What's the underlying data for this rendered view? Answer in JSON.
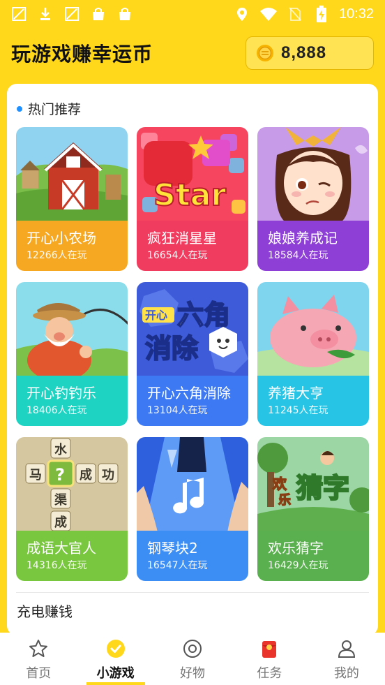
{
  "status_bar": {
    "time": "10:32",
    "left_icons": [
      "no-image-icon",
      "download-icon",
      "no-image-icon",
      "shopping-bag-icon",
      "shopping-bag-icon"
    ],
    "right_icons": [
      "location-icon",
      "wifi-icon",
      "no-sim-icon",
      "battery-charging-icon"
    ]
  },
  "header": {
    "title": "玩游戏赚幸运币",
    "coin_balance": "8,888",
    "coin_icon": "coin-icon"
  },
  "section": {
    "title": "热门推荐",
    "accent": "#1E90FF"
  },
  "games": [
    {
      "name": "开心小农场",
      "players": "12266人在玩",
      "icon": "farm-barn-art",
      "color": "#F7A823"
    },
    {
      "name": "疯狂消星星",
      "players": "16654人在玩",
      "icon": "star-candy-art",
      "color": "#F03C5E"
    },
    {
      "name": "娘娘养成记",
      "players": "18584人在玩",
      "icon": "empress-girl-art",
      "color": "#8E3FD6"
    },
    {
      "name": "开心钓钓乐",
      "players": "18406人在玩",
      "icon": "fisherman-art",
      "color": "#1FD3C2"
    },
    {
      "name": "开心六角消除",
      "players": "13104人在玩",
      "icon": "hexagon-elimination-art",
      "color": "#3D79F2"
    },
    {
      "name": "养猪大亨",
      "players": "11245人在玩",
      "icon": "pig-art",
      "color": "#28C4E6"
    },
    {
      "name": "成语大官人",
      "players": "14316人在玩",
      "icon": "idiom-crossword-art",
      "color": "#79C63F"
    },
    {
      "name": "钢琴块2",
      "players": "16547人在玩",
      "icon": "piano-tiles-art",
      "color": "#3C8EF5"
    },
    {
      "name": "欢乐猜字",
      "players": "16429人在玩",
      "icon": "word-guess-art",
      "color": "#5AB04E"
    }
  ],
  "art_text": {
    "star": "Star",
    "hex_title_1": "六角",
    "hex_title_2": "消除",
    "hex_badge": "开心",
    "idiom_top": "水",
    "idiom_left": "马",
    "idiom_center": "?",
    "idiom_right1": "成",
    "idiom_right2": "功",
    "idiom_bottom1": "渠",
    "idiom_bottom2": "成",
    "guess_small_1": "欢",
    "guess_small_2": "乐",
    "guess_big": "猜字"
  },
  "charge_section": {
    "title": "充电赚钱"
  },
  "bottom_nav": [
    {
      "label": "首页",
      "icon": "star-outline-icon",
      "active": false
    },
    {
      "label": "小游戏",
      "icon": "check-badge-icon",
      "active": true
    },
    {
      "label": "好物",
      "icon": "circle-target-icon",
      "active": false
    },
    {
      "label": "任务",
      "icon": "red-envelope-icon",
      "active": false
    },
    {
      "label": "我的",
      "icon": "user-icon",
      "active": false
    }
  ],
  "colors": {
    "brand_yellow": "#FFD81C",
    "coin_box": "#FFE353",
    "nav_active": "#111111",
    "nav_inactive": "#777777"
  }
}
